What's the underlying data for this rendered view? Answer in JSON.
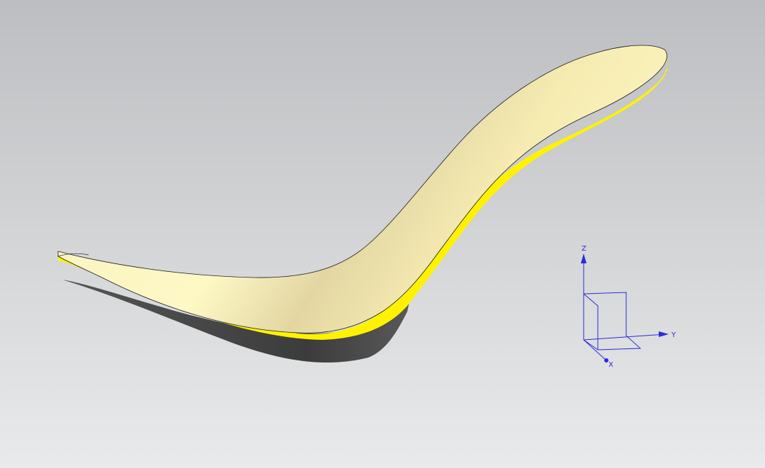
{
  "viewport": {
    "background_top": "#bcbec1",
    "background_bottom": "#e9eaeb"
  },
  "model": {
    "surface_color": "#f6eeb4",
    "edge_color": "#fff200",
    "shadow_color": "#4a4a4a"
  },
  "triad": {
    "color": "#2b2bd8",
    "axes": [
      {
        "label": "Z"
      },
      {
        "label": "Y"
      },
      {
        "label": "X"
      }
    ]
  }
}
